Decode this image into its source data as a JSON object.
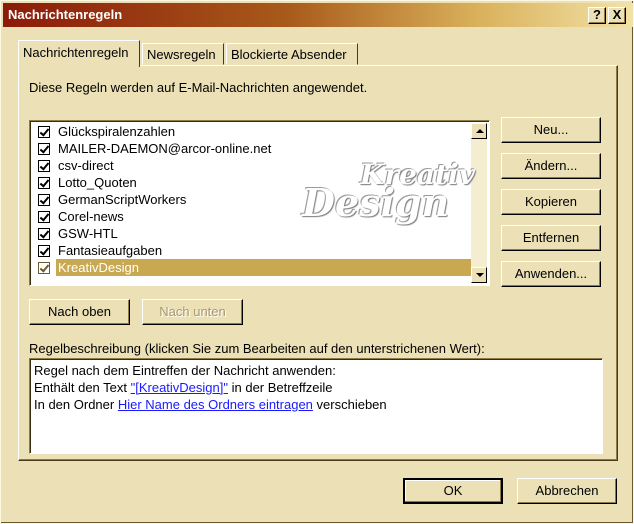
{
  "window": {
    "title": "Nachrichtenregeln",
    "help_label": "?",
    "close_label": "X"
  },
  "tabs": [
    {
      "label": "Nachrichtenregeln",
      "active": true
    },
    {
      "label": "Newsregeln",
      "active": false
    },
    {
      "label": "Blockierte Absender",
      "active": false
    }
  ],
  "intro_text": "Diese Regeln werden auf E-Mail-Nachrichten angewendet.",
  "rules": [
    {
      "label": "Glückspiralenzahlen",
      "checked": true,
      "selected": false
    },
    {
      "label": "MAILER-DAEMON@arcor-online.net",
      "checked": true,
      "selected": false
    },
    {
      "label": "csv-direct",
      "checked": true,
      "selected": false
    },
    {
      "label": "Lotto_Quoten",
      "checked": true,
      "selected": false
    },
    {
      "label": "GermanScriptWorkers",
      "checked": true,
      "selected": false
    },
    {
      "label": "Corel-news",
      "checked": true,
      "selected": false
    },
    {
      "label": "GSW-HTL",
      "checked": true,
      "selected": false
    },
    {
      "label": "Fantasieaufgaben",
      "checked": true,
      "selected": false
    },
    {
      "label": "KreativDesign",
      "checked": true,
      "selected": true
    }
  ],
  "watermark": {
    "line1": "Kreativ",
    "line2": "Design"
  },
  "side_buttons": {
    "new": "Neu...",
    "edit": "Ändern...",
    "copy": "Kopieren",
    "remove": "Entfernen",
    "apply": "Anwenden..."
  },
  "move_buttons": {
    "up": "Nach oben",
    "down": "Nach unten",
    "down_disabled": true
  },
  "description": {
    "label": "Regelbeschreibung (klicken Sie zum Bearbeiten auf den unterstrichenen Wert):",
    "line1": "Regel nach dem Eintreffen der Nachricht anwenden:",
    "line2_prefix": "Enthält den Text ",
    "line2_link": "\"[KreativDesign]\"",
    "line2_suffix": " in der Betreffzeile",
    "line3_prefix": "In den Ordner ",
    "line3_link": "Hier Name des Ordners eintragen",
    "line3_suffix": " verschieben"
  },
  "footer_buttons": {
    "ok": "OK",
    "cancel": "Abbrechen"
  },
  "colors": {
    "selection": "#c8a850",
    "link": "#1a1aff",
    "dialog_bg": "#ece1b6"
  }
}
